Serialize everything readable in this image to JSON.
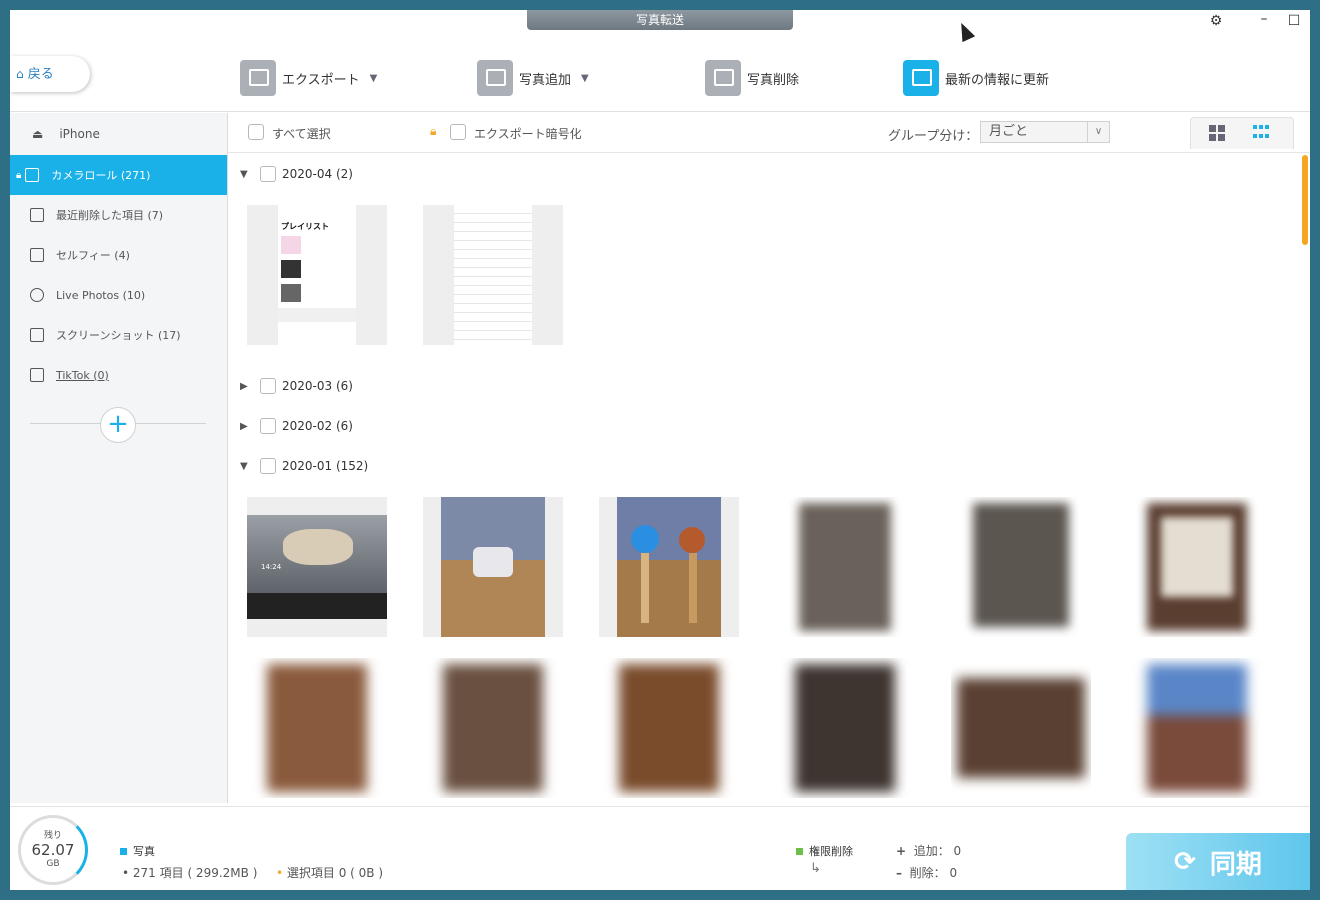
{
  "window": {
    "title": "写真転送"
  },
  "toolbar": {
    "back_label": "戻る",
    "export_label": "エクスポート",
    "add_label": "写真追加",
    "delete_label": "写真削除",
    "refresh_label": "最新の情報に更新"
  },
  "sidebar": {
    "device": "iPhone",
    "items": [
      {
        "label": "カメラロール (271)"
      },
      {
        "label": "最近削除した項目 (7)"
      },
      {
        "label": "セルフィー (4)"
      },
      {
        "label": "Live Photos (10)"
      },
      {
        "label": "スクリーンショット (17)"
      },
      {
        "label": "TikTok (0)"
      }
    ]
  },
  "filter": {
    "select_all": "すべて選択",
    "export_encrypt": "エクスポート暗号化",
    "group_by_label": "グループ分け：",
    "group_by_value": "月ごと"
  },
  "groups": [
    {
      "label": "2020-04",
      "count": "(2)"
    },
    {
      "label": "2020-03",
      "count": "(6)"
    },
    {
      "label": "2020-02",
      "count": "(6)"
    },
    {
      "label": "2020-01",
      "count": "(152)"
    }
  ],
  "thumb_text": {
    "playlist_title": "プレイリスト",
    "clock": "14:24"
  },
  "status": {
    "storage_label": "残り",
    "storage_value": "62.07",
    "storage_unit": "GB",
    "photo_label": "写真",
    "items_text": "271 項目 ( 299.2MB )",
    "selected_text": "選択項目 0 ( 0B )",
    "permission_delete": "権限削除",
    "add_text": "追加： 0",
    "delete_text": "削除： 0",
    "sync_label": "同期"
  },
  "colors": {
    "accent": "#1ab1e8",
    "scroll": "#f5a623",
    "photo_dot": "#1ab1e8",
    "selected_dot": "#f5a623",
    "perm_dot": "#6cc04a"
  }
}
